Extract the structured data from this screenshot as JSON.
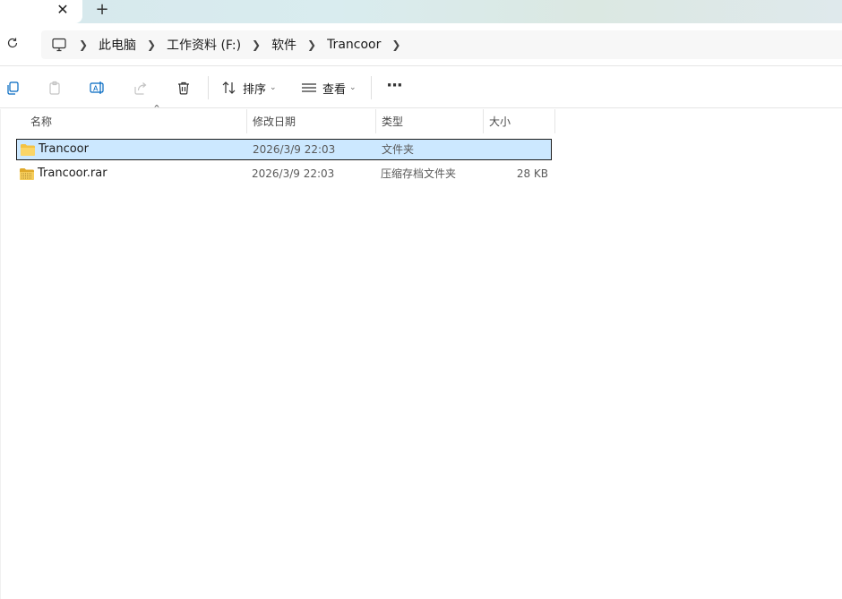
{
  "tabs": {
    "close_glyph": "✕",
    "new_glyph": "+"
  },
  "nav": {
    "refresh_icon": "refresh-icon",
    "breadcrumb": [
      "此电脑",
      "工作资料 (F:)",
      "软件",
      "Trancoor"
    ]
  },
  "commands": {
    "sort_label": "排序",
    "view_label": "查看",
    "more_glyph": "···"
  },
  "columns": {
    "name": "名称",
    "date": "修改日期",
    "type": "类型",
    "size": "大小"
  },
  "files": [
    {
      "name": "Trancoor",
      "date": "2026/3/9 22:03",
      "type": "文件夹",
      "size": "",
      "icon": "folder-icon",
      "selected": true
    },
    {
      "name": "Trancoor.rar",
      "date": "2026/3/9 22:03",
      "type": "压缩存档文件夹",
      "size": "28 KB",
      "icon": "archive-icon",
      "selected": false
    }
  ],
  "colors": {
    "selection": "#cce8ff",
    "folder": "#f3c243",
    "accent": "#0067c0"
  }
}
